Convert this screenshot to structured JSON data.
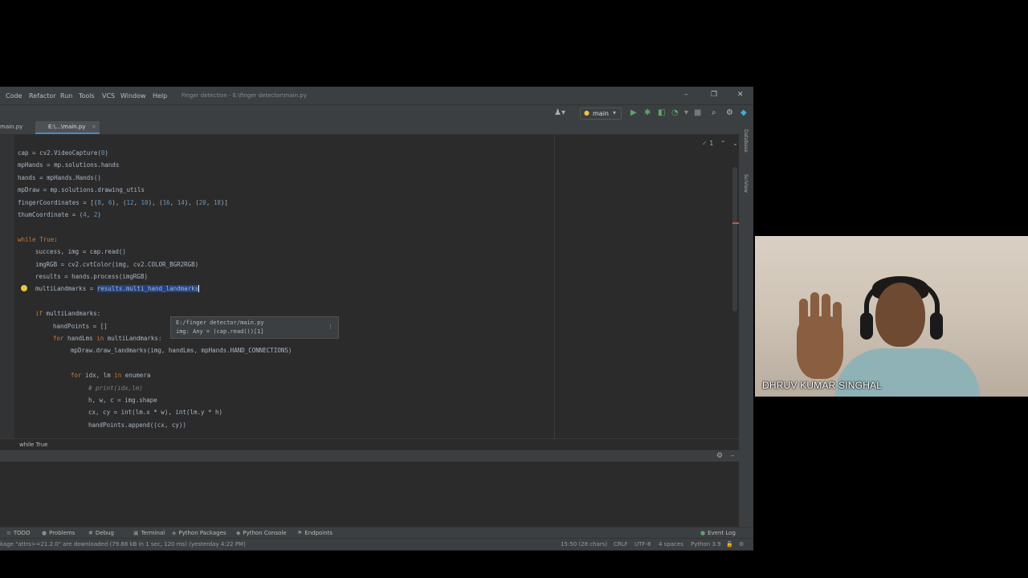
{
  "menu": [
    "Code",
    "Refactor",
    "Run",
    "Tools",
    "VCS",
    "Window",
    "Help"
  ],
  "window_title": "Finger detection - E:\\finger detector\\main.py",
  "toolbar": {
    "run_config": "main"
  },
  "tabs": {
    "left": "main.py",
    "active": "E:\\...\\main.py"
  },
  "inspection": "1",
  "code_lines": [
    {
      "text": "cap = cv2.VideoCapture(0)",
      "indent": 0
    },
    {
      "text": "mpHands = mp.solutions.hands",
      "indent": 0
    },
    {
      "text": "hands = mpHands.Hands()",
      "indent": 0
    },
    {
      "text": "mpDraw = mp.solutions.drawing_utils",
      "indent": 0
    },
    {
      "text": "fingerCoordinates = [(8, 6), (12, 10), (16, 14), (20, 18)]",
      "indent": 0
    },
    {
      "text": "thumCoordinate = (4, 2)",
      "indent": 0
    },
    {
      "text": "",
      "indent": 0
    },
    {
      "text": "while True:",
      "indent": 0
    },
    {
      "text": "success, img = cap.read()",
      "indent": 1
    },
    {
      "text": "imgRGB = cv2.cvtColor(img, cv2.COLOR_BGR2RGB)",
      "indent": 1
    },
    {
      "text": "results = hands.process(imgRGB)",
      "indent": 1
    },
    {
      "text": "multiLandmarks = ",
      "selected": "results.multi_hand_landmarks",
      "indent": 1
    },
    {
      "text": "",
      "indent": 0
    },
    {
      "text": "if multiLandmarks:",
      "indent": 1
    },
    {
      "text": "handPoints = []",
      "indent": 2
    },
    {
      "text": "for handLms in multiLandmarks:",
      "indent": 2
    },
    {
      "text": "mpDraw.draw_landmarks(img, handLms, mpHands.HAND_CONNECTIONS)",
      "indent": 3
    },
    {
      "text": "",
      "indent": 0
    },
    {
      "text": "for idx, lm in enumera",
      "indent": 3
    },
    {
      "text": "# print(idx,lm)",
      "indent": 4,
      "comment": true
    },
    {
      "text": "h, w, c = img.shape",
      "indent": 4
    },
    {
      "text": "cx, cy = int(lm.x * w), int(lm.y * h)",
      "indent": 4
    },
    {
      "text": "handPoints.append((cx, cy))",
      "indent": 4
    }
  ],
  "popup": {
    "path": "E:/finger detector/main.py",
    "signature": "img: Any = (cap.read())[1]"
  },
  "breadcrumb": "while True",
  "toolwindows": [
    {
      "label": "TODO",
      "icon": "list-icon"
    },
    {
      "label": "Problems",
      "icon": "problems-icon"
    },
    {
      "label": "Debug",
      "icon": "debug-icon"
    },
    {
      "label": "Terminal",
      "icon": "terminal-icon"
    },
    {
      "label": "Python Packages",
      "icon": "packages-icon"
    },
    {
      "label": "Python Console",
      "icon": "console-icon"
    },
    {
      "label": "Endpoints",
      "icon": "endpoints-icon"
    }
  ],
  "event_log": "Event Log",
  "status": {
    "message": "kage \"attrs>=21.2.0\" are downloaded (79.88 kB in 1 sec, 120 ms) (yesterday 4:22 PM)",
    "position": "15:50 (28 chars)",
    "line_sep": "CRLF",
    "encoding": "UTF-8",
    "indent": "4 spaces",
    "interpreter": "Python 3.9"
  },
  "sidebar_right": [
    "Database",
    "SciView"
  ],
  "webcam": {
    "name": "DHRUV KUMAR SINGHAL"
  }
}
